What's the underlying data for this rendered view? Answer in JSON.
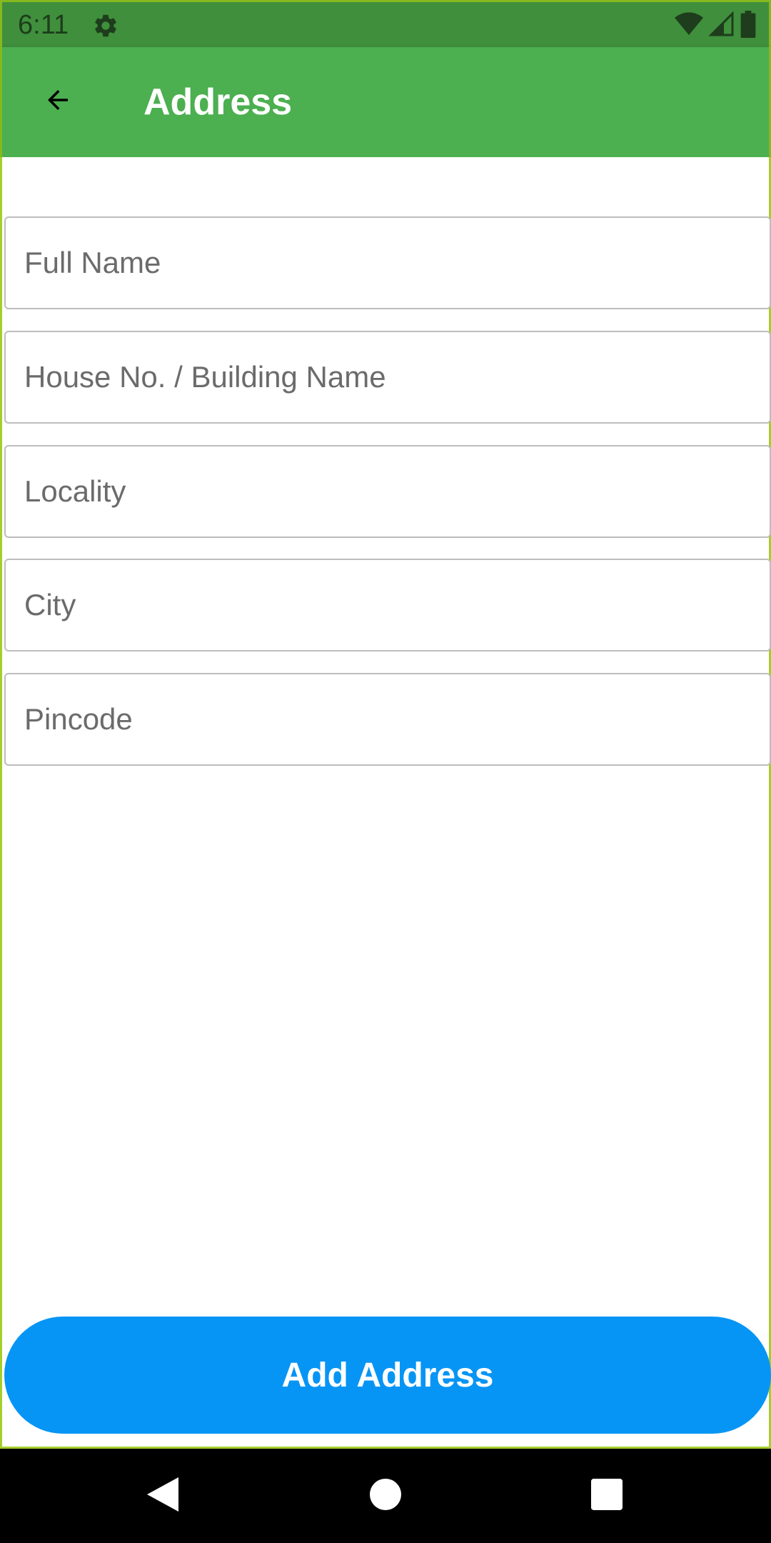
{
  "status_bar": {
    "time": "6:11",
    "icons": [
      "settings-icon",
      "wifi-icon",
      "signal-icon",
      "battery-icon"
    ]
  },
  "app_bar": {
    "title": "Address",
    "back_icon": "arrow-back-icon",
    "color": "#4caf50"
  },
  "form": {
    "fields": [
      {
        "name": "full-name-field",
        "placeholder": "Full Name",
        "value": ""
      },
      {
        "name": "house-building-field",
        "placeholder": "House No. / Building Name",
        "value": ""
      },
      {
        "name": "locality-field",
        "placeholder": "Locality",
        "value": ""
      },
      {
        "name": "city-field",
        "placeholder": "City",
        "value": ""
      },
      {
        "name": "pincode-field",
        "placeholder": "Pincode",
        "value": ""
      }
    ],
    "submit_label": "Add Address",
    "submit_color": "#0795f5"
  },
  "nav_bar": {
    "buttons": [
      "nav-back-icon",
      "nav-home-icon",
      "nav-recents-icon"
    ]
  }
}
